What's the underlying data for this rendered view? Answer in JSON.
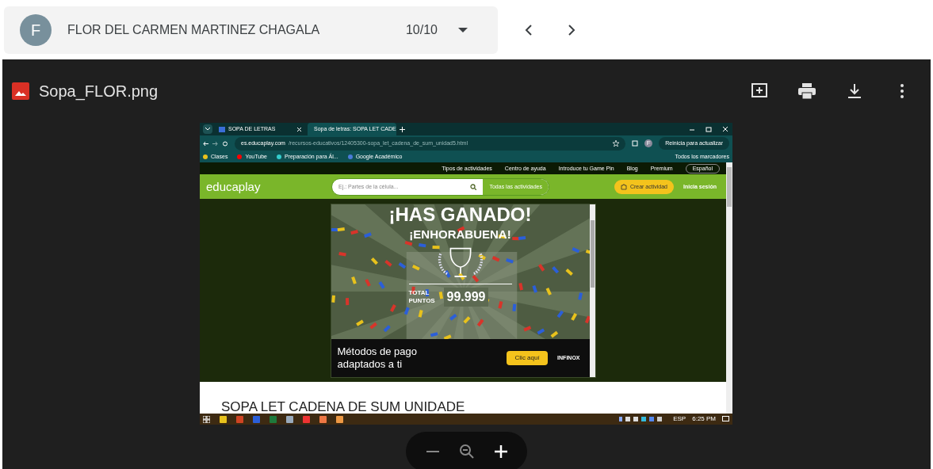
{
  "header": {
    "avatar": "F",
    "name": "FLOR DEL CARMEN MARTINEZ CHAGALA",
    "counter": "10/10"
  },
  "viewer": {
    "file_name": "Sopa_FLOR.png"
  },
  "screenshot": {
    "tabs": [
      {
        "label": "SOPA DE LETRAS",
        "selected": false
      },
      {
        "label": "Sopa de letras: SOPA LET CADE",
        "selected": true
      }
    ],
    "url_host": "es.educaplay.com",
    "url_path": "/recursos-educativos/12405300-sopa_let_cadena_de_sum_unidad5.html",
    "profile": "F",
    "update_button": "Reinicia para actualizar",
    "bookmarks": [
      "Clases",
      "YouTube",
      "Preparación para Ál...",
      "Google Académico"
    ],
    "all_bookmarks": "Todos los marcadores",
    "top_links": [
      "Tipos de actividades",
      "Centro de ayuda",
      "Introduce tu Game Pin",
      "Blog",
      "Premium"
    ],
    "language": "Español",
    "logo": "educaplay",
    "search_placeholder": "Ej.: Partes de la célula...",
    "all_activities": "Todas las actividades",
    "create": "Crear actividad",
    "login": "Inicia sesión",
    "game": {
      "title": "¡HAS GANADO!",
      "subtitle": "¡ENHORABUENA!",
      "total_label": "TOTAL PUNTOS",
      "score": "99.999"
    },
    "ad": {
      "text": "Métodos de pago adaptados a ti",
      "button": "Clic aquí",
      "brand": "INFINOX"
    },
    "page_title": "SOPA LET CADENA DE SUM UNIDADE",
    "taskbar": {
      "language": "ESP",
      "time": "6:25 PM"
    }
  }
}
